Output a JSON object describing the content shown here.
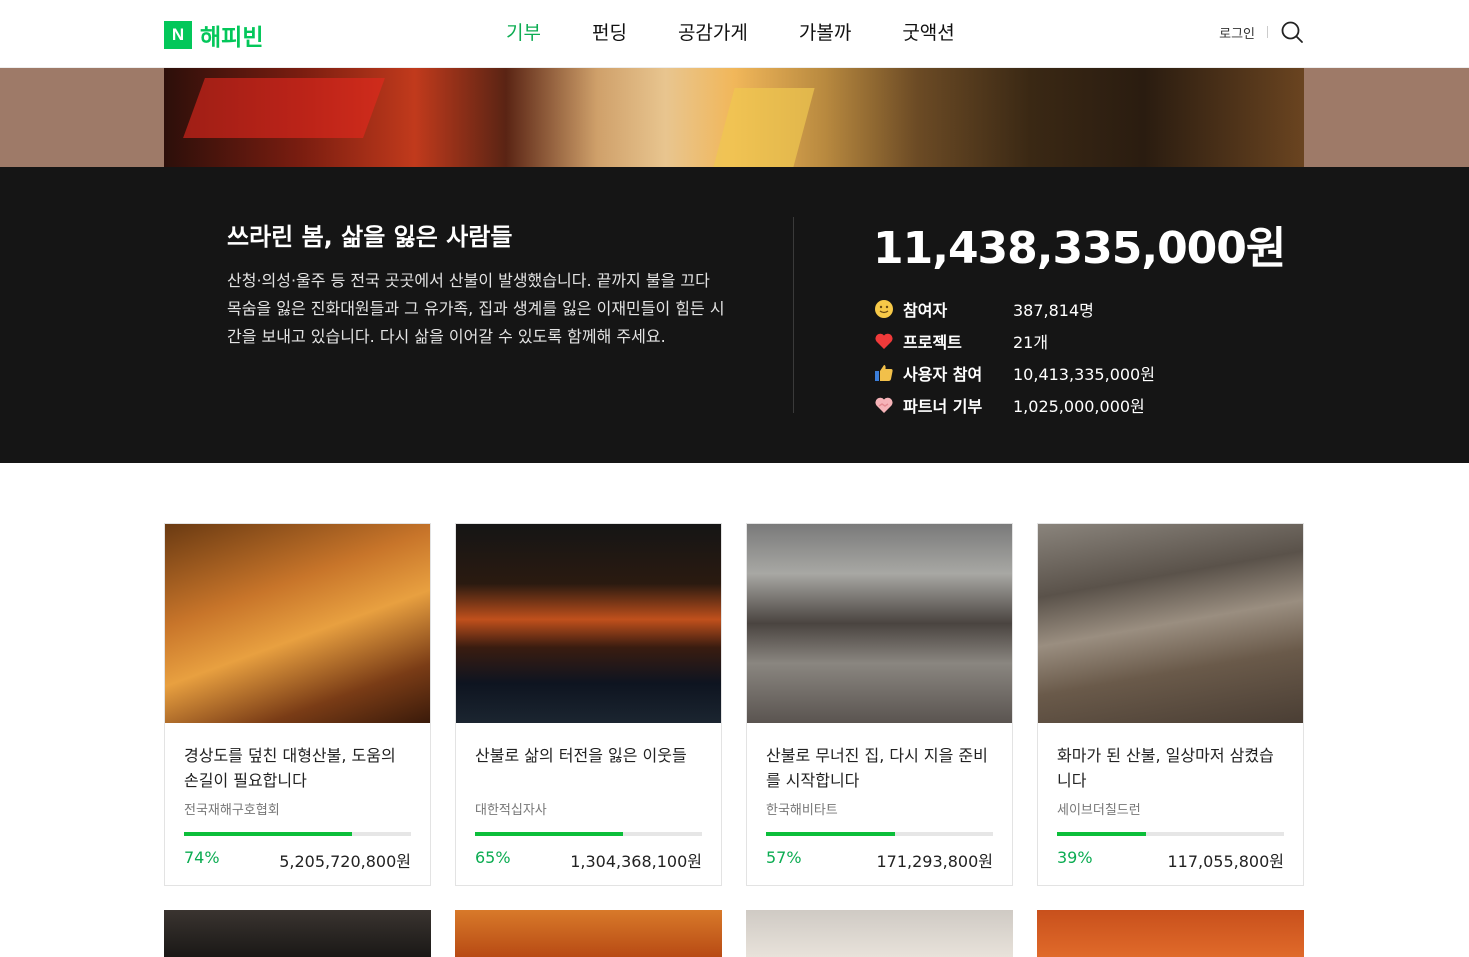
{
  "header": {
    "logo_mark": "N",
    "logo_text": "해피빈",
    "nav": [
      "기부",
      "펀딩",
      "공감가게",
      "가볼까",
      "굿액션"
    ],
    "login": "로그인"
  },
  "summary": {
    "title": "쓰라린 봄, 삶을 잃은 사람들",
    "description": "산청·의성·울주 등 전국 곳곳에서 산불이 발생했습니다. 끝까지 불을 끄다 목숨을 잃은 진화대원들과 그 유가족, 집과 생계를 잃은 이재민들이 힘든 시간을 보내고 있습니다. 다시 삶을 이어갈 수 있도록 함께해 주세요.",
    "total": "11,438,335,000원",
    "stats": [
      {
        "icon": "smile-icon",
        "label": "참여자",
        "value": "387,814명"
      },
      {
        "icon": "heart-icon",
        "label": "프로젝트",
        "value": "21개"
      },
      {
        "icon": "thumbs-up-icon",
        "label": "사용자 참여",
        "value": "10,413,335,000원"
      },
      {
        "icon": "handshake-heart-icon",
        "label": "파트너 기부",
        "value": "1,025,000,000원"
      }
    ]
  },
  "cards": [
    {
      "title": "경상도를 덮친 대형산불, 도움의 손길이 필요합니다",
      "org": "전국재해구호협회",
      "percent": 74,
      "percent_label": "74%",
      "amount": "5,205,720,800원"
    },
    {
      "title": "산불로 삶의 터전을 잃은 이웃들",
      "org": "대한적십자사",
      "percent": 65,
      "percent_label": "65%",
      "amount": "1,304,368,100원"
    },
    {
      "title": "산불로 무너진 집, 다시 지을 준비를 시작합니다",
      "org": "한국해비타트",
      "percent": 57,
      "percent_label": "57%",
      "amount": "171,293,800원"
    },
    {
      "title": "화마가 된 산불, 일상마저 삼켰습니다",
      "org": "세이브더칠드런",
      "percent": 39,
      "percent_label": "39%",
      "amount": "117,055,800원"
    }
  ],
  "colors": {
    "accent": "#0cac52",
    "brand": "#03c75a",
    "dark_band": "#151515"
  }
}
